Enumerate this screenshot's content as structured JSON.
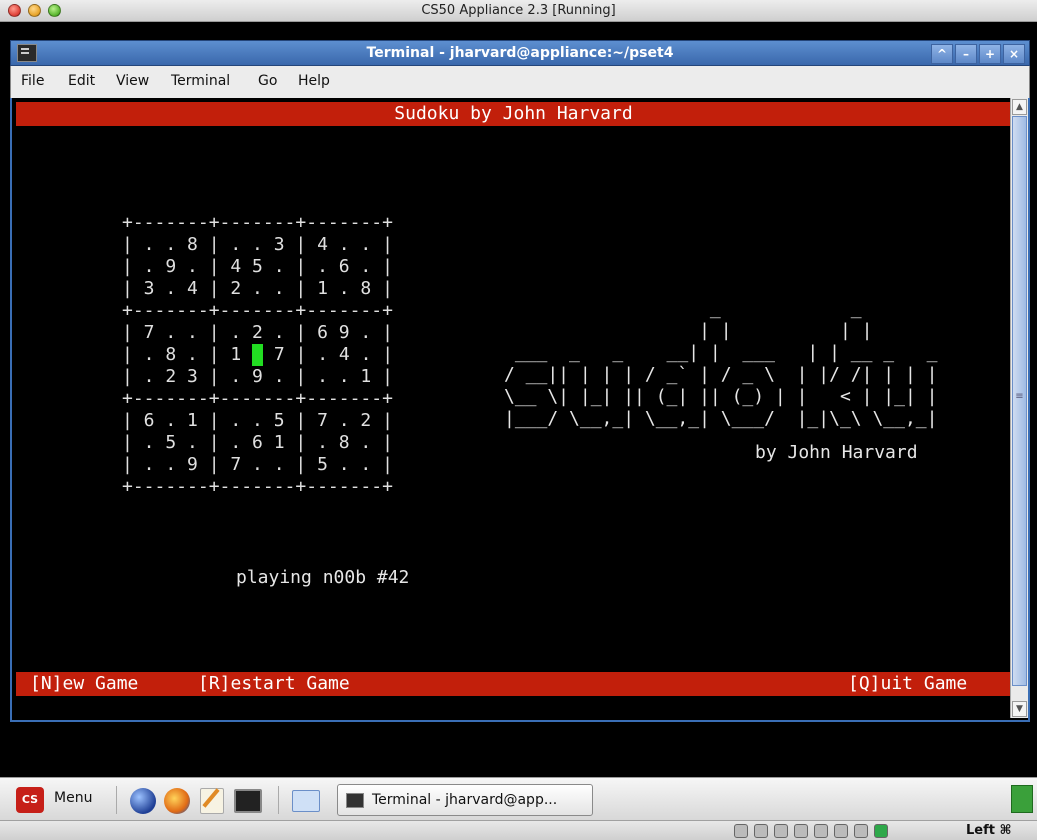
{
  "mac_window": {
    "title": "CS50 Appliance 2.3 [Running]"
  },
  "xfce_window": {
    "title": "Terminal - jharvard@appliance:~/pset4",
    "buttons": [
      "^",
      "–",
      "+",
      "×"
    ]
  },
  "menu": {
    "items": [
      "File",
      "Edit",
      "View",
      "Terminal",
      "Go",
      "Help"
    ]
  },
  "terminal": {
    "header": "Sudoku by John Harvard",
    "board": {
      "border": "+-------+-------+-------+",
      "rows": [
        "| . . 8 | . . 3 | 4 . . |",
        "| . 9 . | 4 5 . | . 6 . |",
        "| 3 . 4 | 2 . . | 1 . 8 |",
        "| 7 . . | . 2 . | 6 9 . |",
        "| . 8 . | 1 ",
        "| . 2 3 | . 9 . | . . 1 |",
        "| 6 . 1 | . . 5 | 7 . 2 |",
        "| . 5 . | . 6 1 | . 8 . |",
        "| . . 9 | 7 . . | 5 . . |"
      ],
      "cursor_row_after": " 7 | . 4 . |"
    },
    "logo_art": [
      "                   _            _          ",
      "                  | |          | |         ",
      " ___  _   _    __| |  ___   | | __ _   _ ",
      "/ __|| | | | / _` | / _ \\  | |/ /| | | |",
      "\\__ \\| |_| || (_| || (_) | |   < | |_| |",
      "|___/ \\__,_| \\__,_| \\___/  |_|\\_\\ \\__,_|"
    ],
    "byline": "by John Harvard",
    "status": "playing n00b #42",
    "footer": {
      "new_game": "[N]ew Game",
      "restart_game": "[R]estart Game",
      "quit_game": "[Q]uit Game"
    }
  },
  "panel": {
    "menu_icon_text": "CS",
    "menu_label": "Menu",
    "task_label": "Terminal - jharvard@app..."
  },
  "statusbar": {
    "hostkey": "Left ⌘"
  }
}
